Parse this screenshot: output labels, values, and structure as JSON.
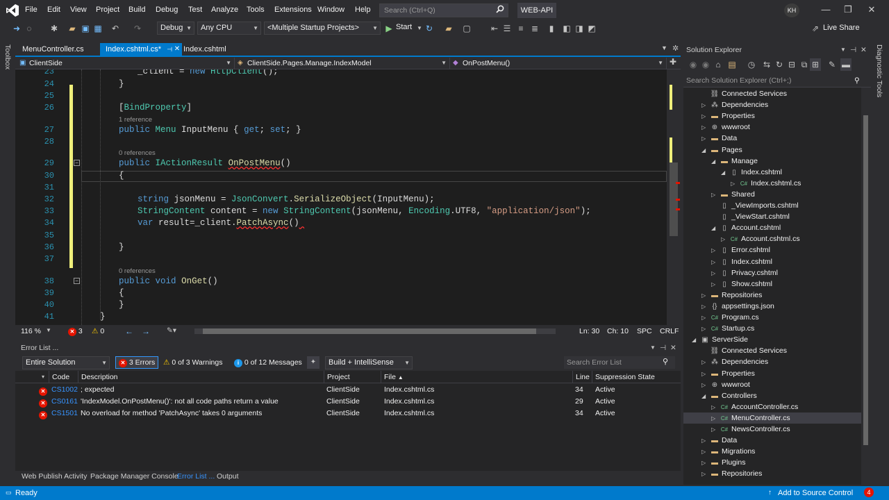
{
  "menu": [
    "File",
    "Edit",
    "View",
    "Project",
    "Build",
    "Debug",
    "Test",
    "Analyze",
    "Tools",
    "Extensions",
    "Window",
    "Help"
  ],
  "search_placeholder": "Search (Ctrl+Q)",
  "solution_name": "WEB-API",
  "user_initials": "KH",
  "toolbar": {
    "config": "Debug",
    "platform": "Any CPU",
    "startup": "<Multiple Startup Projects>",
    "start_label": "Start",
    "live_share": "Live Share"
  },
  "side_strips": {
    "left": "Toolbox",
    "right": "Diagnostic Tools"
  },
  "doc_tabs": [
    "MenuController.cs",
    "Index.cshtml.cs*",
    "Index.cshtml"
  ],
  "nav": {
    "project": "ClientSide",
    "type": "ClientSide.Pages.Manage.IndexModel",
    "member": "OnPostMenu()"
  },
  "code_lines": [
    {
      "n": "23",
      "text": "_client = new HttpClient();"
    },
    {
      "n": "24",
      "text": "}"
    },
    {
      "n": "25",
      "text": ""
    },
    {
      "n": "26",
      "text": "[BindProperty]"
    },
    {
      "n": "27",
      "text": "public Menu InputMenu { get; set; }"
    },
    {
      "n": "28",
      "text": ""
    },
    {
      "n": "29",
      "text": "public IActionResult OnPostMenu()"
    },
    {
      "n": "30",
      "text": "{"
    },
    {
      "n": "31",
      "text": ""
    },
    {
      "n": "32",
      "text": "string jsonMenu = JsonConvert.SerializeObject(InputMenu);"
    },
    {
      "n": "33",
      "text": "StringContent content = new StringContent(jsonMenu, Encoding.UTF8, \"application/json\");"
    },
    {
      "n": "34",
      "text": "var result=_client.PatchAsync()"
    },
    {
      "n": "35",
      "text": ""
    },
    {
      "n": "36",
      "text": "}"
    },
    {
      "n": "37",
      "text": ""
    },
    {
      "n": "38",
      "text": "public void OnGet()"
    },
    {
      "n": "39",
      "text": "{"
    },
    {
      "n": "40",
      "text": "}"
    },
    {
      "n": "41",
      "text": "}"
    }
  ],
  "code_lens": {
    "one_ref": "1 reference",
    "zero_ref": "0 references"
  },
  "editor_status": {
    "zoom": "116 %",
    "errors": "3",
    "warnings": "0",
    "ln": "Ln: 30",
    "ch": "Ch: 10",
    "spc": "SPC",
    "crlf": "CRLF"
  },
  "error_list": {
    "title": "Error List ...",
    "scope": "Entire Solution",
    "errors_btn": "3 Errors",
    "warnings_btn": "0 of 3 Warnings",
    "messages_btn": "0 of 12 Messages",
    "build_filter": "Build + IntelliSense",
    "search_placeholder": "Search Error List",
    "columns": [
      "Code",
      "Description",
      "Project",
      "File",
      "Line",
      "Suppression State"
    ],
    "rows": [
      {
        "code": "CS1002",
        "desc": "; expected",
        "project": "ClientSide",
        "file": "Index.cshtml.cs",
        "line": "34",
        "state": "Active"
      },
      {
        "code": "CS0161",
        "desc": "'IndexModel.OnPostMenu()': not all code paths return a value",
        "project": "ClientSide",
        "file": "Index.cshtml.cs",
        "line": "29",
        "state": "Active"
      },
      {
        "code": "CS1501",
        "desc": "No overload for method 'PatchAsync' takes 0 arguments",
        "project": "ClientSide",
        "file": "Index.cshtml.cs",
        "line": "34",
        "state": "Active"
      }
    ]
  },
  "bottom_tabs": [
    "Web Publish Activity",
    "Package Manager Console",
    "Error List ...",
    "Output"
  ],
  "status": {
    "ready": "Ready",
    "source_control": "Add to Source Control",
    "badge": "4"
  },
  "solution_explorer": {
    "title": "Solution Explorer",
    "search_placeholder": "Search Solution Explorer (Ctrl+;)",
    "nodes": [
      {
        "label": "Connected Services",
        "icon": "connected-services-icon",
        "indent": 2,
        "exp": ""
      },
      {
        "label": "Dependencies",
        "icon": "dependencies-icon",
        "indent": 2,
        "exp": "▷"
      },
      {
        "label": "Properties",
        "icon": "folder-icon",
        "indent": 2,
        "exp": "▷"
      },
      {
        "label": "wwwroot",
        "icon": "globe-icon",
        "indent": 2,
        "exp": "▷"
      },
      {
        "label": "Data",
        "icon": "folder-icon",
        "indent": 2,
        "exp": "▷"
      },
      {
        "label": "Pages",
        "icon": "folder-icon",
        "indent": 2,
        "exp": "◢"
      },
      {
        "label": "Manage",
        "icon": "folder-icon",
        "indent": 3,
        "exp": "◢"
      },
      {
        "label": "Index.cshtml",
        "icon": "razor-file-icon",
        "indent": 4,
        "exp": "◢"
      },
      {
        "label": "Index.cshtml.cs",
        "icon": "csharp-file-icon",
        "indent": 5,
        "exp": "▷"
      },
      {
        "label": "Shared",
        "icon": "folder-icon",
        "indent": 3,
        "exp": "▷"
      },
      {
        "label": "_ViewImports.cshtml",
        "icon": "razor-file-icon",
        "indent": 3,
        "exp": ""
      },
      {
        "label": "_ViewStart.cshtml",
        "icon": "razor-file-icon",
        "indent": 3,
        "exp": ""
      },
      {
        "label": "Account.cshtml",
        "icon": "razor-file-icon",
        "indent": 3,
        "exp": "◢"
      },
      {
        "label": "Account.cshtml.cs",
        "icon": "csharp-file-icon",
        "indent": 4,
        "exp": "▷"
      },
      {
        "label": "Error.cshtml",
        "icon": "razor-file-icon",
        "indent": 3,
        "exp": "▷"
      },
      {
        "label": "Index.cshtml",
        "icon": "razor-file-icon",
        "indent": 3,
        "exp": "▷"
      },
      {
        "label": "Privacy.cshtml",
        "icon": "razor-file-icon",
        "indent": 3,
        "exp": "▷"
      },
      {
        "label": "Show.cshtml",
        "icon": "razor-file-icon",
        "indent": 3,
        "exp": "▷"
      },
      {
        "label": "Repositories",
        "icon": "folder-icon",
        "indent": 2,
        "exp": "▷"
      },
      {
        "label": "appsettings.json",
        "icon": "json-file-icon",
        "indent": 2,
        "exp": "▷"
      },
      {
        "label": "Program.cs",
        "icon": "csharp-file-icon",
        "indent": 2,
        "exp": "▷"
      },
      {
        "label": "Startup.cs",
        "icon": "csharp-file-icon",
        "indent": 2,
        "exp": "▷"
      },
      {
        "label": "ServerSide",
        "icon": "project-icon",
        "indent": 1,
        "exp": "◢"
      },
      {
        "label": "Connected Services",
        "icon": "connected-services-icon",
        "indent": 2,
        "exp": ""
      },
      {
        "label": "Dependencies",
        "icon": "dependencies-icon",
        "indent": 2,
        "exp": "▷"
      },
      {
        "label": "Properties",
        "icon": "folder-icon",
        "indent": 2,
        "exp": "▷"
      },
      {
        "label": "wwwroot",
        "icon": "globe-icon",
        "indent": 2,
        "exp": "▷"
      },
      {
        "label": "Controllers",
        "icon": "folder-icon",
        "indent": 2,
        "exp": "◢"
      },
      {
        "label": "AccountController.cs",
        "icon": "csharp-file-icon",
        "indent": 3,
        "exp": "▷"
      },
      {
        "label": "MenuController.cs",
        "icon": "csharp-file-icon",
        "indent": 3,
        "exp": "▷",
        "selected": true
      },
      {
        "label": "NewsController.cs",
        "icon": "csharp-file-icon",
        "indent": 3,
        "exp": "▷"
      },
      {
        "label": "Data",
        "icon": "folder-icon",
        "indent": 2,
        "exp": "▷"
      },
      {
        "label": "Migrations",
        "icon": "folder-icon",
        "indent": 2,
        "exp": "▷"
      },
      {
        "label": "Plugins",
        "icon": "folder-icon",
        "indent": 2,
        "exp": "▷"
      },
      {
        "label": "Repositories",
        "icon": "folder-icon",
        "indent": 2,
        "exp": "▷"
      }
    ]
  },
  "colors": {
    "accent": "#007acc",
    "error": "#e51400",
    "change_bar": "#efef7b"
  }
}
